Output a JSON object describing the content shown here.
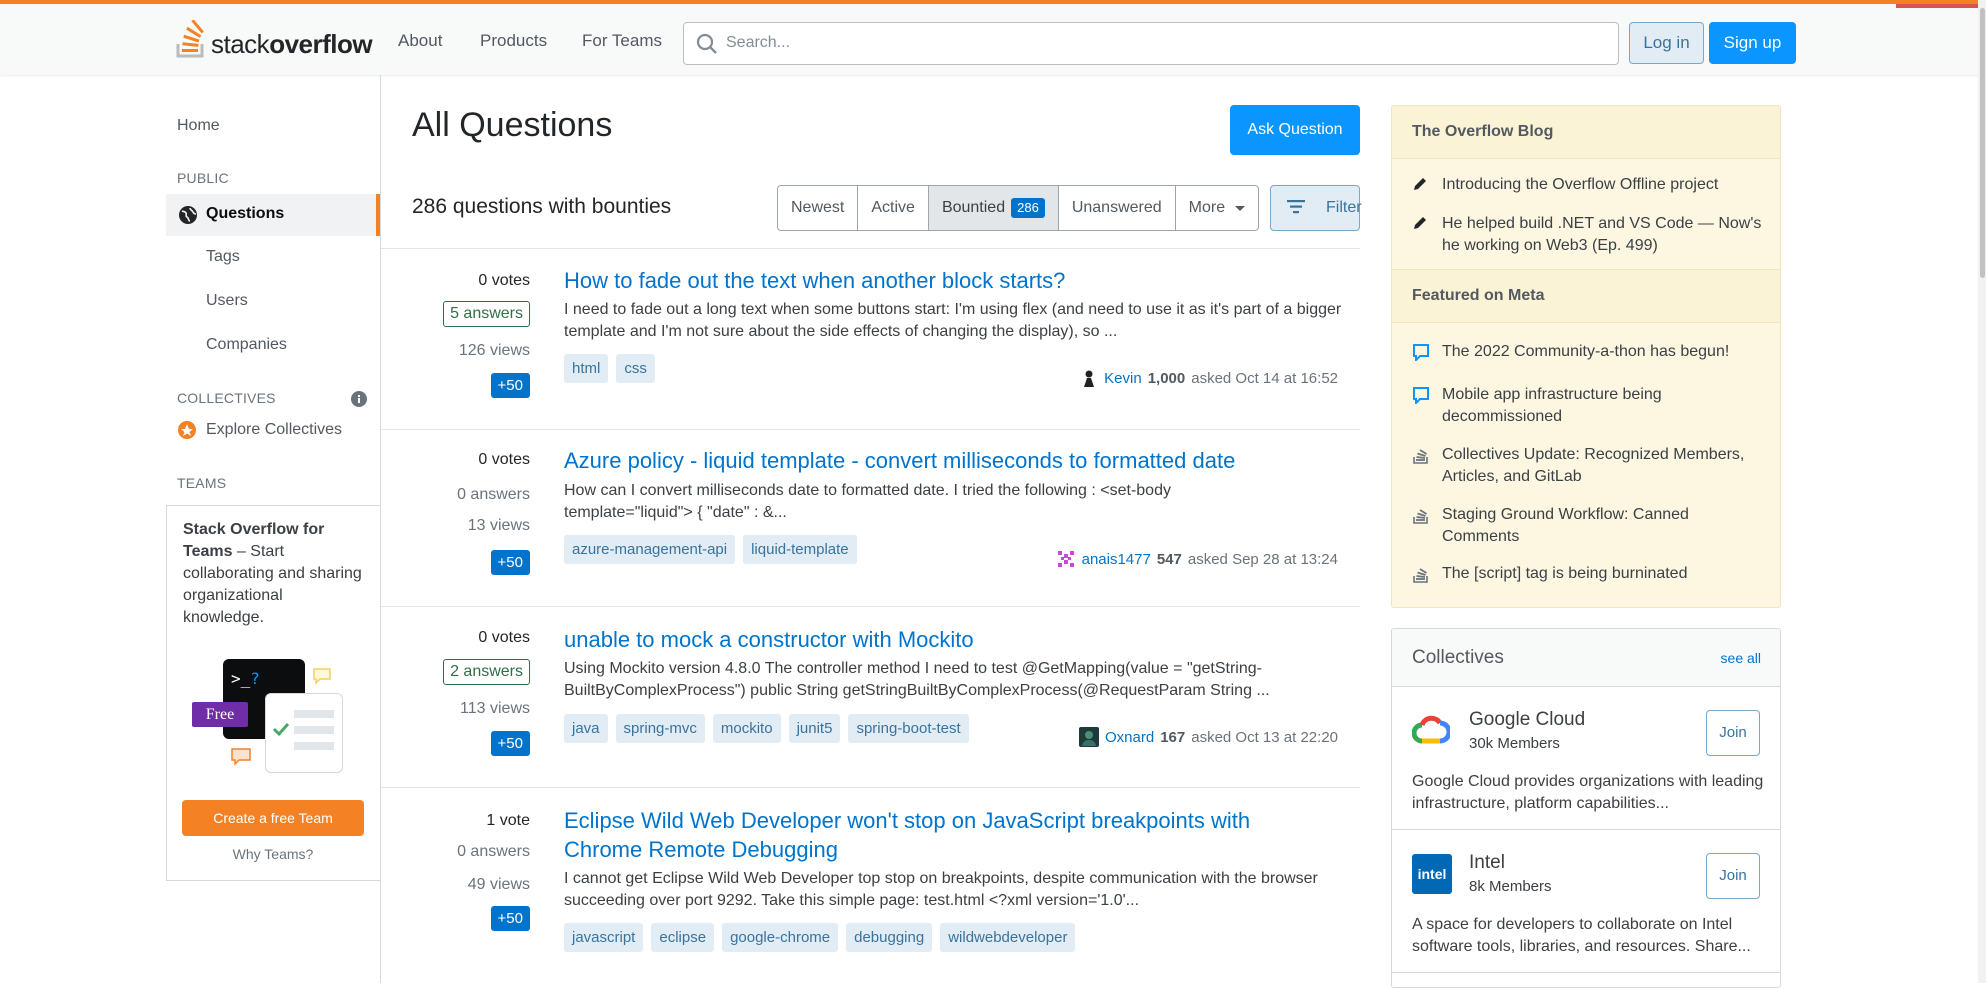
{
  "header": {
    "logo_text_a": "stack",
    "logo_text_b": "overflow",
    "nav": [
      "About",
      "Products",
      "For Teams"
    ],
    "search_placeholder": "Search...",
    "login_label": "Log in",
    "signup_label": "Sign up"
  },
  "sidebar": {
    "home": "Home",
    "public_section": "PUBLIC",
    "items": [
      {
        "label": "Questions",
        "icon": "globe-icon",
        "active": true
      },
      {
        "label": "Tags"
      },
      {
        "label": "Users"
      },
      {
        "label": "Companies"
      }
    ],
    "collectives_section": "COLLECTIVES",
    "explore_collectives": "Explore Collectives",
    "teams_section": "TEAMS",
    "teams_title": "Stack Overflow for Teams",
    "teams_desc": " – Start collaborating and sharing organizational knowledge.",
    "free_badge": "Free",
    "create_team_label": "Create a free Team",
    "why_teams": "Why Teams?",
    "accent_color": "#f48225"
  },
  "main": {
    "title": "All Questions",
    "ask_label": "Ask Question",
    "count_text": "286 questions with bounties",
    "tabs": [
      {
        "label": "Newest"
      },
      {
        "label": "Active"
      },
      {
        "label": "Bountied",
        "badge": "286",
        "active": true
      },
      {
        "label": "Unanswered"
      },
      {
        "label": "More"
      }
    ],
    "filter_label": "Filter",
    "questions": [
      {
        "votes": "0 votes",
        "answers": "5 answers",
        "has_answers": true,
        "views": "126 views",
        "bounty": "+50",
        "title": "How to fade out the text when another block starts?",
        "excerpt": "I need to fade out a long text when some buttons start: I'm using flex (and need to use it as it's part of a bigger template and I'm not sure about the side effects of changing the display), so ...",
        "tags": [
          "html",
          "css"
        ],
        "user": "Kevin",
        "rep": "1,000",
        "asked": "asked Oct 14 at 16:52"
      },
      {
        "votes": "0 votes",
        "answers": "0 answers",
        "has_answers": false,
        "views": "13 views",
        "bounty": "+50",
        "title": "Azure policy - liquid template - convert milliseconds to formatted date",
        "excerpt": "How can I convert milliseconds date to formatted date. I tried the following : <set-body template=\"liquid\"> { \"date\" : &...",
        "tags": [
          "azure-management-api",
          "liquid-template"
        ],
        "user": "anais1477",
        "rep": "547",
        "asked": "asked Sep 28 at 13:24"
      },
      {
        "votes": "0 votes",
        "answers": "2 answers",
        "has_answers": true,
        "views": "113 views",
        "bounty": "+50",
        "title": "unable to mock a constructor with Mockito",
        "excerpt": "Using Mockito version 4.8.0 The controller method I need to test @GetMapping(value = \"getString-BuiltByComplexProcess\") public String getStringBuiltByComplexProcess(@RequestParam String ...",
        "tags": [
          "java",
          "spring-mvc",
          "mockito",
          "junit5",
          "spring-boot-test"
        ],
        "user": "Oxnard",
        "rep": "167",
        "asked": "asked Oct 13 at 22:20"
      },
      {
        "votes": "1 vote",
        "answers": "0 answers",
        "has_answers": false,
        "views": "49 views",
        "bounty": "+50",
        "title": "Eclipse Wild Web Developer won't stop on JavaScript breakpoints with Chrome Remote Debugging",
        "excerpt": "I cannot get Eclipse Wild Web Developer top stop on breakpoints, despite communication with the browser succeeding over port 9292. Take this simple page: test.html <?xml version='1.0'...",
        "tags": [
          "javascript",
          "eclipse",
          "google-chrome",
          "debugging",
          "wildwebdeveloper"
        ]
      }
    ]
  },
  "right": {
    "blog_heading": "The Overflow Blog",
    "blog_items": [
      "Introducing the Overflow Offline project",
      "He helped build .NET and VS Code — Now's he working on Web3 (Ep. 499)"
    ],
    "meta_heading": "Featured on Meta",
    "meta_items": [
      "The 2022 Community-a-thon has begun!",
      "Mobile app infrastructure being decommissioned",
      "Collectives Update: Recognized Members, Articles, and GitLab",
      "Staging Ground Workflow: Canned Comments",
      "The [script] tag is being burninated"
    ],
    "collectives_heading": "Collectives",
    "see_all": "see all",
    "collectives": [
      {
        "name": "Google Cloud",
        "members": "30k Members",
        "desc": "Google Cloud provides organizations with leading infrastructure, platform capabilities...",
        "join": "Join"
      },
      {
        "name": "Intel",
        "logo_text": "intel",
        "members": "8k Members",
        "desc": "A space for developers to collaborate on Intel software tools, libraries, and resources. Share...",
        "join": "Join"
      }
    ]
  }
}
